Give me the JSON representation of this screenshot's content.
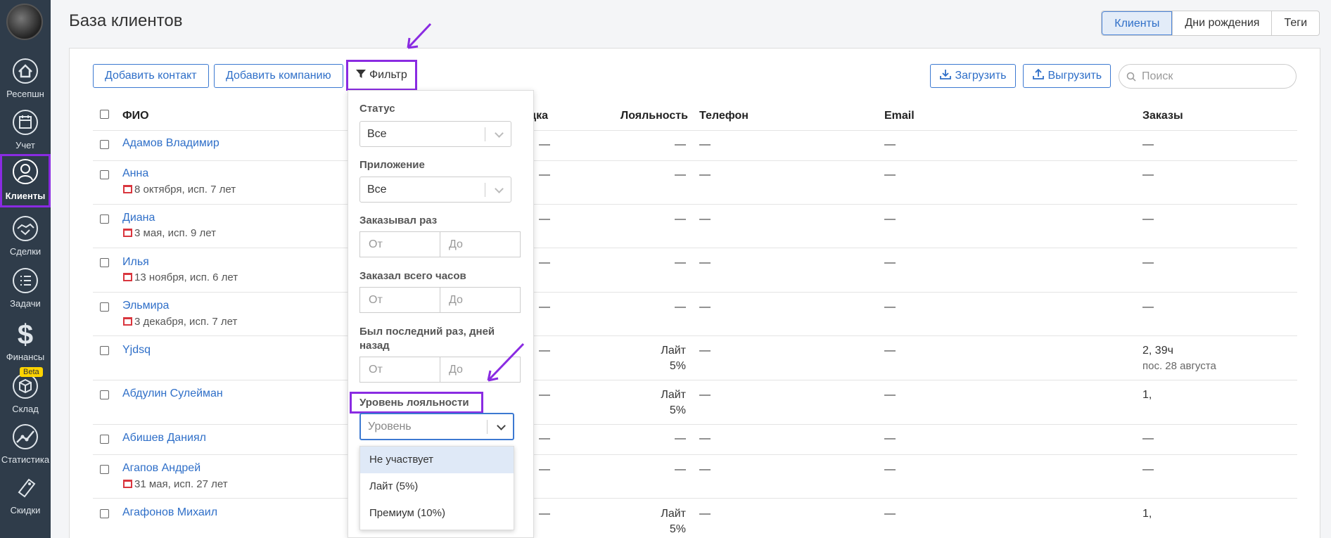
{
  "sidebar": {
    "items": [
      {
        "label": "Ресепшн",
        "icon": "home-icon"
      },
      {
        "label": "Учет",
        "icon": "calendar-icon"
      },
      {
        "label": "Клиенты",
        "icon": "user-icon"
      },
      {
        "label": "Сделки",
        "icon": "handshake-icon"
      },
      {
        "label": "Задачи",
        "icon": "checklist-icon"
      },
      {
        "label": "Финансы",
        "icon": "dollar-icon"
      },
      {
        "label": "Склад",
        "icon": "box-icon",
        "badge": "Beta"
      },
      {
        "label": "Статистика",
        "icon": "chart-icon"
      },
      {
        "label": "Скидки",
        "icon": "sale-tag-icon"
      }
    ]
  },
  "header": {
    "title": "База клиентов",
    "tabs": [
      "Клиенты",
      "Дни рождения",
      "Теги"
    ]
  },
  "toolbar": {
    "add_contact": "Добавить контакт",
    "add_company": "Добавить компанию",
    "filter": "Фильтр",
    "upload": "Загрузить",
    "download": "Выгрузить",
    "search_placeholder": "Поиск"
  },
  "table": {
    "headers": {
      "name": "ФИО",
      "discount": "дка",
      "loyalty": "Лояльность",
      "phone": "Телефон",
      "email": "Email",
      "orders": "Заказы"
    },
    "rows": [
      {
        "name": "Адамов Владимир",
        "sub": "",
        "disc": "—",
        "loyalty": "—",
        "loyalty2": "",
        "phone": "—",
        "email": "—",
        "orders": "—",
        "orders2": ""
      },
      {
        "name": "Анна",
        "sub": "8 октября, исп. 7 лет",
        "disc": "—",
        "loyalty": "—",
        "loyalty2": "",
        "phone": "—",
        "email": "—",
        "orders": "—",
        "orders2": ""
      },
      {
        "name": "Диана",
        "sub": "3 мая, исп. 9 лет",
        "disc": "—",
        "loyalty": "—",
        "loyalty2": "",
        "phone": "—",
        "email": "—",
        "orders": "—",
        "orders2": ""
      },
      {
        "name": "Илья",
        "sub": "13 ноября, исп. 6 лет",
        "disc": "—",
        "loyalty": "—",
        "loyalty2": "",
        "phone": "—",
        "email": "—",
        "orders": "—",
        "orders2": ""
      },
      {
        "name": "Эльмира",
        "sub": "3 декабря, исп. 7 лет",
        "disc": "—",
        "loyalty": "—",
        "loyalty2": "",
        "phone": "—",
        "email": "—",
        "orders": "—",
        "orders2": ""
      },
      {
        "name": "Yjdsq",
        "sub": "",
        "disc": "—",
        "loyalty": "Лайт",
        "loyalty2": "5%",
        "phone": "—",
        "email": "—",
        "orders": "2, 39ч",
        "orders2": "пос. 28 августа"
      },
      {
        "name": "Абдулин Сулейман",
        "sub": "",
        "disc": "—",
        "loyalty": "Лайт",
        "loyalty2": "5%",
        "phone": "—",
        "email": "—",
        "orders": "1,",
        "orders2": ""
      },
      {
        "name": "Абишев Даниял",
        "sub": "",
        "disc": "—",
        "loyalty": "—",
        "loyalty2": "",
        "phone": "—",
        "email": "—",
        "orders": "—",
        "orders2": ""
      },
      {
        "name": "Агапов Андрей",
        "sub": "31 мая, исп. 27 лет",
        "disc": "—",
        "loyalty": "—",
        "loyalty2": "",
        "phone": "—",
        "email": "—",
        "orders": "—",
        "orders2": ""
      },
      {
        "name": "Агафонов Михаил",
        "sub": "",
        "disc": "—",
        "loyalty": "Лайт",
        "loyalty2": "5%",
        "phone": "—",
        "email": "—",
        "orders": "1,",
        "orders2": ""
      }
    ]
  },
  "filter_panel": {
    "status_label": "Статус",
    "status_value": "Все",
    "app_label": "Приложение",
    "app_value": "Все",
    "ordered_times_label": "Заказывал раз",
    "ordered_hours_label": "Заказал всего часов",
    "last_visit_label": "Был последний раз, дней назад",
    "from_placeholder": "От",
    "to_placeholder": "До",
    "loyalty_label": "Уровень лояльности",
    "loyalty_placeholder": "Уровень",
    "loyalty_options": [
      "Не участвует",
      "Лайт (5%)",
      "Премиум (10%)"
    ]
  },
  "colors": {
    "sidebar": "#2f3c4a",
    "link": "#2f6fc8",
    "highlight": "#8a2be2"
  }
}
